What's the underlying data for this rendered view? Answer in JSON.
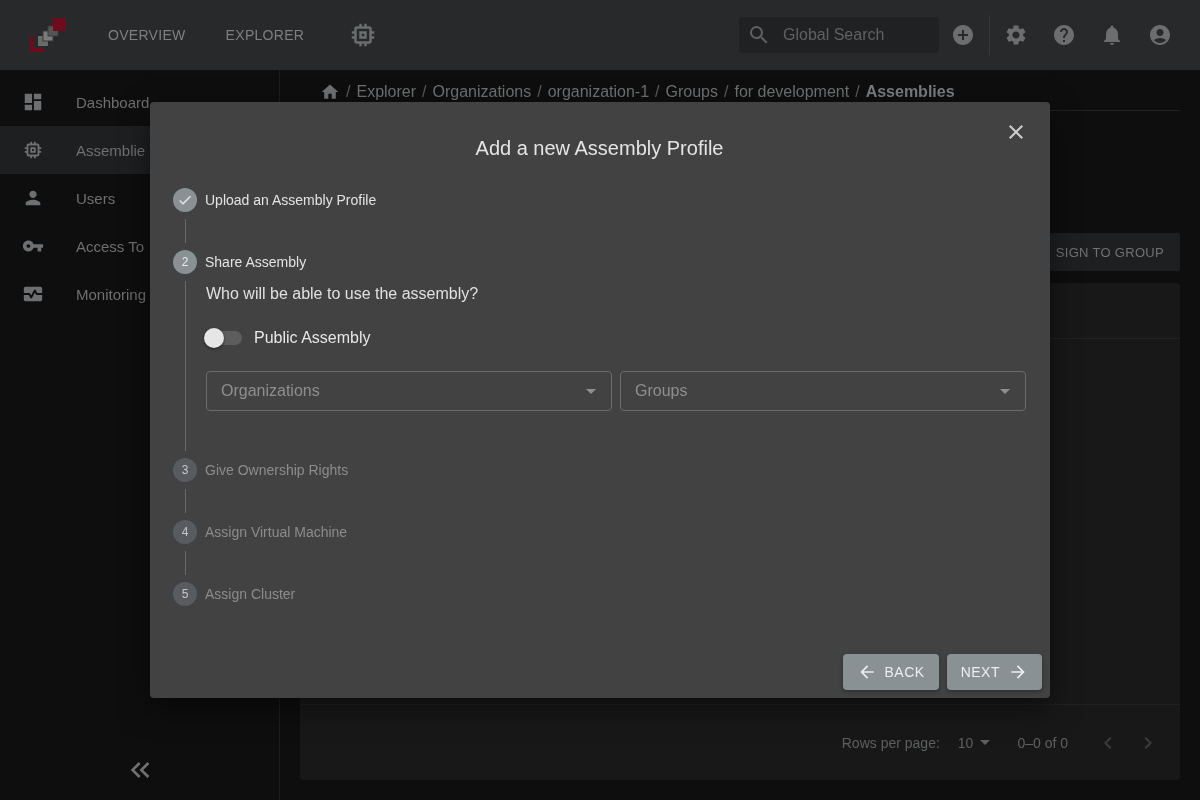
{
  "topbar": {
    "nav": [
      {
        "label": "OVERVIEW",
        "selected": false
      },
      {
        "label": "EXPLORER",
        "selected": false
      }
    ],
    "search": {
      "placeholder": "Global Search"
    }
  },
  "sidebar": {
    "items": [
      {
        "label": "Dashboard",
        "selected": false
      },
      {
        "label": "Assemblie",
        "selected": true
      },
      {
        "label": "Users",
        "selected": false
      },
      {
        "label": "Access To",
        "selected": false
      },
      {
        "label": "Monitoring",
        "selected": false
      }
    ]
  },
  "breadcrumb": {
    "separator": "/",
    "items": [
      "Explorer",
      "Organizations",
      "organization-1",
      "Groups",
      "for development",
      "Assemblies"
    ]
  },
  "assign_button": "SIGN TO GROUP",
  "pagination": {
    "rows_label": "Rows per page:",
    "rows_value": "10",
    "range": "0–0 of 0"
  },
  "dialog": {
    "title": "Add a new Assembly Profile",
    "steps": [
      {
        "label": "Upload an Assembly Profile",
        "completed": true,
        "active": false
      },
      {
        "number": "2",
        "label": "Share Assembly",
        "completed": false,
        "active": true
      },
      {
        "number": "3",
        "label": "Give Ownership Rights",
        "completed": false,
        "active": false
      },
      {
        "number": "4",
        "label": "Assign Virtual Machine",
        "completed": false,
        "active": false
      },
      {
        "number": "5",
        "label": "Assign Cluster",
        "completed": false,
        "active": false
      }
    ],
    "question": "Who will be able to use the assembly?",
    "public_toggle": {
      "label": "Public Assembly",
      "on": false
    },
    "selects": [
      {
        "placeholder": "Organizations"
      },
      {
        "placeholder": "Groups"
      }
    ],
    "back": "BACK",
    "next": "NEXT"
  }
}
